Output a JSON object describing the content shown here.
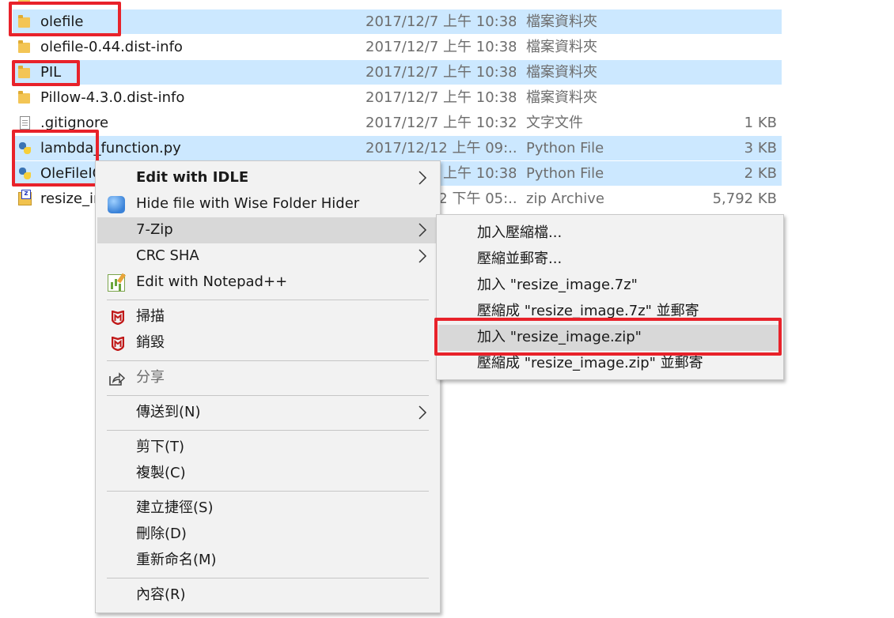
{
  "files": [
    {
      "icon": "folder-icon",
      "name": "olefile",
      "date": "2017/12/7 上午 10:38",
      "type": "檔案資料夾",
      "size": "",
      "selected": true
    },
    {
      "icon": "folder-icon",
      "name": "olefile-0.44.dist-info",
      "date": "2017/12/7 上午 10:38",
      "type": "檔案資料夾",
      "size": "",
      "selected": false
    },
    {
      "icon": "folder-icon",
      "name": "PIL",
      "date": "2017/12/7 上午 10:38",
      "type": "檔案資料夾",
      "size": "",
      "selected": true
    },
    {
      "icon": "folder-icon",
      "name": "Pillow-4.3.0.dist-info",
      "date": "2017/12/7 上午 10:38",
      "type": "檔案資料夾",
      "size": "",
      "selected": false
    },
    {
      "icon": "text-document-icon",
      "name": ".gitignore",
      "date": "2017/12/7 上午 10:32",
      "type": "文字文件",
      "size": "1 KB",
      "selected": false
    },
    {
      "icon": "python-file-icon",
      "name": "lambda_function.py",
      "date": "2017/12/12 上午 09:...",
      "type": "Python File",
      "size": "3 KB",
      "selected": true
    },
    {
      "icon": "python-file-icon",
      "name": "OleFileIO_PL.py",
      "date": "2017/12/7 上午 10:38",
      "type": "Python File",
      "size": "2 KB",
      "selected": true
    },
    {
      "icon": "zip-archive-icon",
      "name": "resize_image.zip",
      "date": "2017/12/12 下午 05:...",
      "type": "zip Archive",
      "size": "5,792 KB",
      "selected": false
    }
  ],
  "context_menu": {
    "items": [
      {
        "label": "Edit with IDLE",
        "bold": true,
        "submenu": true,
        "icon": ""
      },
      {
        "label": "Hide file with Wise Folder Hider",
        "icon": "wise-folder-hider-icon"
      },
      {
        "label": "7-Zip",
        "submenu": true,
        "active": true,
        "icon": ""
      },
      {
        "label": "CRC SHA",
        "submenu": true,
        "icon": ""
      },
      {
        "label": "Edit with Notepad++",
        "icon": "notepad-plus-plus-icon"
      },
      {
        "label": "掃描",
        "icon": "mcafee-shield-icon"
      },
      {
        "label": "銷毀",
        "icon": "mcafee-shield-icon"
      },
      {
        "label": "分享",
        "icon": "share-icon",
        "disabled": true
      },
      {
        "label": "傳送到(N)",
        "submenu": true,
        "icon": ""
      },
      {
        "label": "剪下(T)",
        "icon": ""
      },
      {
        "label": "複製(C)",
        "icon": ""
      },
      {
        "label": "建立捷徑(S)",
        "icon": ""
      },
      {
        "label": "刪除(D)",
        "icon": ""
      },
      {
        "label": "重新命名(M)",
        "icon": ""
      },
      {
        "label": "內容(R)",
        "icon": ""
      }
    ]
  },
  "submenu_7zip": {
    "items": [
      {
        "label": "加入壓縮檔..."
      },
      {
        "label": "壓縮並郵寄..."
      },
      {
        "label": "加入 \"resize_image.7z\""
      },
      {
        "label": "壓縮成 \"resize_image.7z\" 並郵寄"
      },
      {
        "label": "加入 \"resize_image.zip\"",
        "active": true
      },
      {
        "label": "壓縮成 \"resize_image.zip\" 並郵寄"
      }
    ]
  },
  "colors": {
    "selection": "#cce8ff",
    "menu_background": "#f2f2f2",
    "menu_hover": "#d8d8d8",
    "annotation": "#e8222a",
    "mcafee_red": "#c01818"
  }
}
